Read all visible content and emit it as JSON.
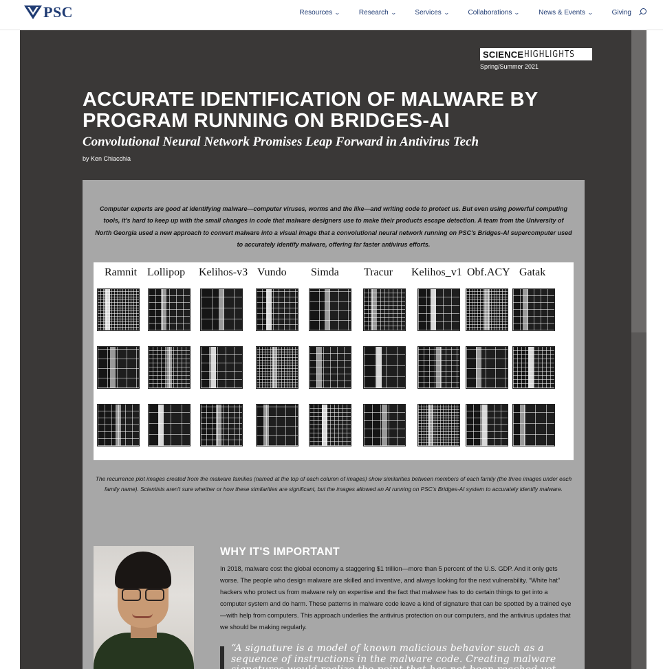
{
  "header": {
    "logo_text": "PSC",
    "nav": [
      "Resources",
      "Research",
      "Services",
      "Collaborations",
      "News & Events",
      "Giving"
    ],
    "nav_has_dropdown": [
      true,
      true,
      true,
      true,
      true,
      false
    ]
  },
  "badge": {
    "science": "SCIENCE",
    "highlights": "HIGHLIGHTS",
    "season": "Spring/Summer 2021"
  },
  "article": {
    "title": "ACCURATE IDENTIFICATION OF MALWARE BY PROGRAM RUNNING ON BRIDGES-AI",
    "subtitle": "Convolutional Neural Network Promises Leap Forward in Antivirus Tech",
    "byline": "by Ken Chiacchia",
    "intro": "Computer experts are good at identifying malware—computer viruses, worms and the like—and writing code to protect us. But even using powerful computing tools, it's hard to keep up with the small changes in code that malware designers use to make their products escape detection. A team from the University of North Georgia used a new approach to convert malware into a visual image that a convolutional neural network running on PSC's Bridges-AI supercomputer used to accurately identify malware, offering far faster antivirus efforts.",
    "figure_labels": [
      "Ramnit",
      "Lollipop",
      "Kelihos-v3",
      "Vundo",
      "Simda",
      "Tracur",
      "Kelihos_v1",
      "Obf.ACY",
      "Gatak"
    ],
    "caption": "The recurrence plot images created from the malware families (named at the top of each column of images) show similarities between members of each family (the three images under each family name). Scientists aren't sure whether or how these similarities are significant, but the images allowed an AI running on PSC's Bridges-AI system to accurately identify malware.",
    "why_title": "WHY IT'S IMPORTANT",
    "why_body": "In 2018, malware cost the global economy a staggering $1 trillion—more than 5 percent of the U.S. GDP. And it only gets worse. The people who design malware are skilled and inventive, and always looking for the next vulnerability. “White hat” hackers who protect us from malware rely on expertise and the fact that malware has to do certain things to get into a computer system and do harm. These patterns in malware code leave a kind of signature that can be spotted by a trained eye—with help from computers. This approach underlies the antivirus protection on our computers, and the antivirus updates that we should be making regularly.",
    "quote": "“A signature is a model of known malicious behavior such as a sequence of instructions in the malware code. Creating malware signatures would realize the point that has not been reached yet,"
  },
  "colors": {
    "brand": "#1f3b73",
    "hero_bg": "#3a3837",
    "panel_bg": "#a7a7a7"
  }
}
